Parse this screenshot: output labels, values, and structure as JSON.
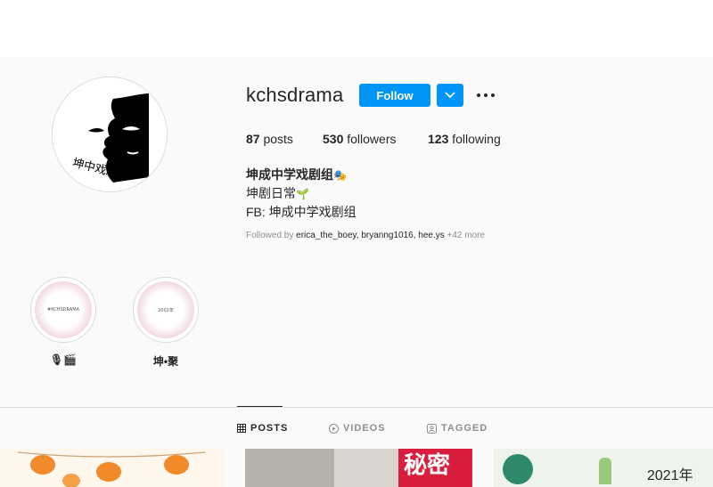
{
  "profile": {
    "username": "kchsdrama",
    "follow_label": "Follow",
    "posts_count": "87",
    "posts_label": " posts",
    "followers_count": "530",
    "followers_label": " followers",
    "following_count": "123",
    "following_label": " following",
    "bio_name": "坤成中学戏剧组",
    "bio_name_emoji": "🎭",
    "bio_line1": "坤剧日常",
    "bio_line1_emoji": "🌱",
    "bio_line2": "FB: 坤成中学戏剧组",
    "followed_by_prefix": "Followed by ",
    "followed_by_names": "erica_the_boey, bryanng1016, hee.ys",
    "followed_by_more": " +42 more",
    "avatar_text": "坤中戏剧"
  },
  "highlights": [
    {
      "label": "🎙🎬",
      "cover_text": "#KCHSDRAMA"
    },
    {
      "label": "坤•聚",
      "cover_text": "2002年"
    }
  ],
  "tabs": [
    {
      "label": "POSTS",
      "icon": "grid-icon",
      "active": true
    },
    {
      "label": "VIDEOS",
      "icon": "play-icon",
      "active": false
    },
    {
      "label": "TAGGED",
      "icon": "tag-icon",
      "active": false
    }
  ],
  "post_thumbnails": [
    {
      "text": ""
    },
    {
      "text": "秘密"
    },
    {
      "text": "2021年"
    }
  ],
  "colors": {
    "accent": "#0095f6",
    "background": "#fafafa",
    "text": "#262626",
    "muted": "#8e8e8e",
    "border": "#dbdbdb"
  }
}
